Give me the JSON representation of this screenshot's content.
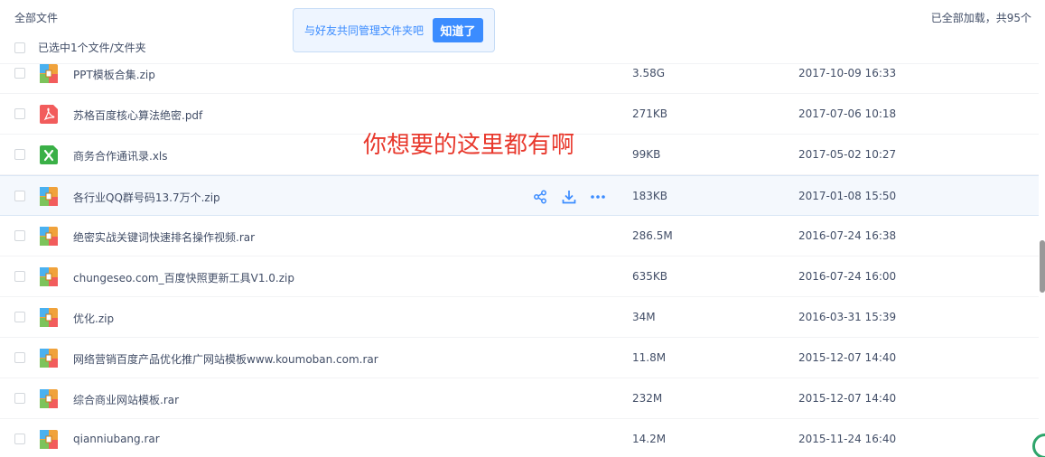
{
  "header": {
    "breadcrumb": "全部文件",
    "load_status": "已全部加载，共95个",
    "selection_text": "已选中1个文件/文件夹"
  },
  "tooltip": {
    "text": "与好友共同管理文件夹吧",
    "button_label": "知道了"
  },
  "overlay_text": "你想要的这里都有啊",
  "colors": {
    "accent": "#3b8cff",
    "overlay": "#e8382c",
    "zip": "#f0a23b",
    "pdf": "#f25c5c",
    "xls": "#3ab047"
  },
  "files": [
    {
      "name": "PPT模板合集.zip",
      "size": "3.58G",
      "date": "2017-10-09 16:33",
      "icon": "zip-icon"
    },
    {
      "name": "苏格百度核心算法绝密.pdf",
      "size": "271KB",
      "date": "2017-07-06 10:18",
      "icon": "pdf-icon"
    },
    {
      "name": "商务合作通讯录.xls",
      "size": "99KB",
      "date": "2017-05-02 10:27",
      "icon": "xls-icon"
    },
    {
      "name": "各行业QQ群号码13.7万个.zip",
      "size": "183KB",
      "date": "2017-01-08 15:50",
      "icon": "zip-icon"
    },
    {
      "name": "绝密实战关键词快速排名操作视频.rar",
      "size": "286.5M",
      "date": "2016-07-24 16:38",
      "icon": "zip-icon"
    },
    {
      "name": "chungeseo.com_百度快照更新工具V1.0.zip",
      "size": "635KB",
      "date": "2016-07-24 16:00",
      "icon": "zip-icon"
    },
    {
      "name": "优化.zip",
      "size": "34M",
      "date": "2016-03-31 15:39",
      "icon": "zip-icon"
    },
    {
      "name": "网络营销百度产品优化推广网站模板www.koumoban.com.rar",
      "size": "11.8M",
      "date": "2015-12-07 14:40",
      "icon": "zip-icon"
    },
    {
      "name": "综合商业网站模板.rar",
      "size": "232M",
      "date": "2015-12-07 14:40",
      "icon": "zip-icon"
    },
    {
      "name": "qianniubang.rar",
      "size": "14.2M",
      "date": "2015-11-24 16:40",
      "icon": "zip-icon"
    }
  ],
  "row_actions": [
    "share-icon",
    "download-icon",
    "more-icon"
  ]
}
